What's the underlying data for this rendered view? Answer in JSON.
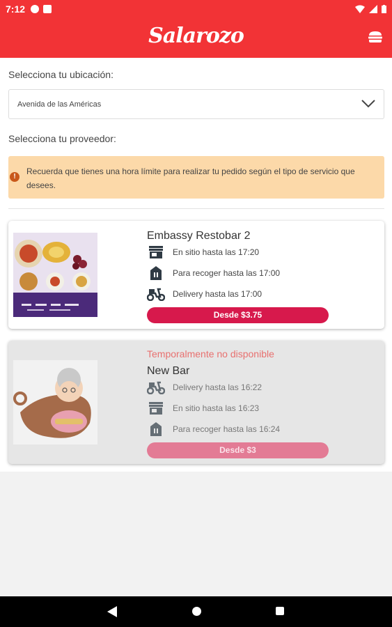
{
  "status_bar": {
    "time": "7:12"
  },
  "app_bar": {
    "logo": "Salarozo",
    "menu_icon": "burger-menu-icon"
  },
  "location": {
    "label": "Selecciona tu ubicación:",
    "selected": "Avenida de las Américas"
  },
  "provider": {
    "label": "Selecciona tu proveedor:"
  },
  "notice": {
    "text": "Recuerda que tienes una hora límite para realizar tu pedido según el tipo de servicio que desees."
  },
  "vendors": [
    {
      "name": "Embassy Restobar 2",
      "services": [
        {
          "icon": "storefront-icon",
          "text": "En sitio hasta las 17:20"
        },
        {
          "icon": "takeaway-bag-icon",
          "text": "Para recoger hasta las 17:00"
        },
        {
          "icon": "delivery-scooter-icon",
          "text": "Delivery hasta las 17:00"
        }
      ],
      "price": "Desde $3.75"
    },
    {
      "status": "Temporalmente no disponible",
      "name": "New Bar",
      "services": [
        {
          "icon": "delivery-scooter-icon",
          "text": "Delivery hasta las 16:22"
        },
        {
          "icon": "storefront-icon",
          "text": "En sitio hasta las 16:23"
        },
        {
          "icon": "takeaway-bag-icon",
          "text": "Para recoger hasta las 16:24"
        }
      ],
      "price": "Desde $3"
    }
  ],
  "colors": {
    "primary": "#f23336",
    "price_button": "#d7194c",
    "notice_bg": "#fcd9a9",
    "unavailable": "#e8706f"
  }
}
